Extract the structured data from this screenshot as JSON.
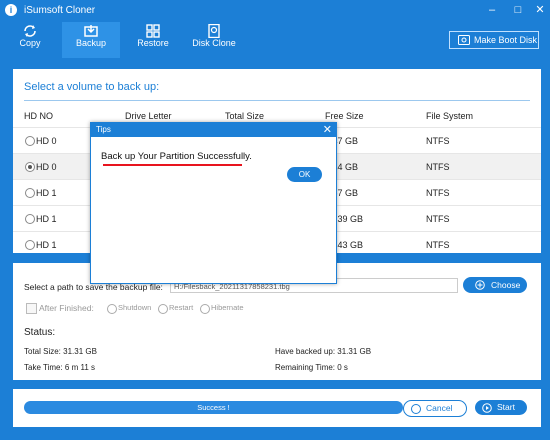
{
  "window": {
    "title": "iSumsoft Cloner"
  },
  "toolbar": {
    "copy": "Copy",
    "backup": "Backup",
    "restore": "Restore",
    "disk_clone": "Disk Clone",
    "make_boot_disk": "Make Boot Disk"
  },
  "volume_panel": {
    "title": "Select a volume to back up:",
    "columns": [
      "HD NO",
      "Drive Letter",
      "Total Size",
      "Free Size",
      "File System"
    ],
    "rows": [
      {
        "hd": "HD 0",
        "free": "3.47 GB",
        "fs": "NTFS",
        "selected": false
      },
      {
        "hd": "HD 0",
        "free": "1.24 GB",
        "fs": "NTFS",
        "selected": true
      },
      {
        "hd": "HD 1",
        "free": "0.57 GB",
        "fs": "NTFS",
        "selected": false
      },
      {
        "hd": "HD 1",
        "free": "29.39 GB",
        "fs": "NTFS",
        "selected": false
      },
      {
        "hd": "HD 1",
        "free": "61.43 GB",
        "fs": "NTFS",
        "selected": false
      }
    ]
  },
  "save_panel": {
    "path_label": "Select a path to save the backup file:",
    "path_value": "H:/Filesback_20211317858231.tbg",
    "choose": "Choose",
    "after_finished": "After Finished:",
    "options": [
      "Shutdown",
      "Restart",
      "Hibernate"
    ],
    "status_title": "Status:",
    "total_size": "Total Size: 31.31 GB",
    "have_backed_up": "Have backed up: 31.31 GB",
    "take_time": "Take Time: 6 m 11 s",
    "remaining_time": "Remaining Time: 0 s"
  },
  "bottom": {
    "progress_label": "Success !",
    "progress_fraction": 1.0,
    "cancel": "Cancel",
    "start": "Start"
  },
  "dialog": {
    "title": "Tips",
    "message": "Back up Your Partition Successfully.",
    "ok": "OK"
  },
  "colors": {
    "accent": "#1c7fd6",
    "underline": "#e8141e"
  }
}
